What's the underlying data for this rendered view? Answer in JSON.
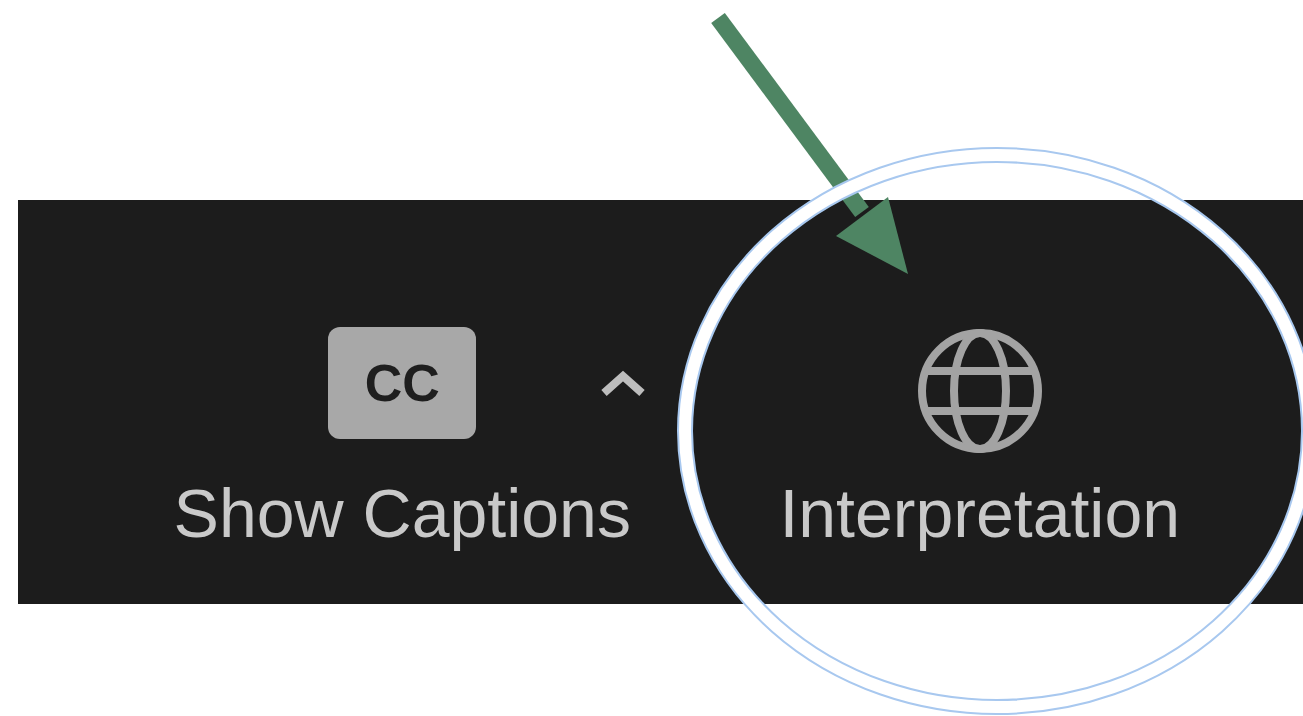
{
  "toolbar": {
    "items": [
      {
        "kind": "captions",
        "icon_text": "CC",
        "label": "Show Captions",
        "has_menu": true
      },
      {
        "kind": "globe",
        "label": "Interpretation",
        "has_menu": false
      }
    ]
  }
}
